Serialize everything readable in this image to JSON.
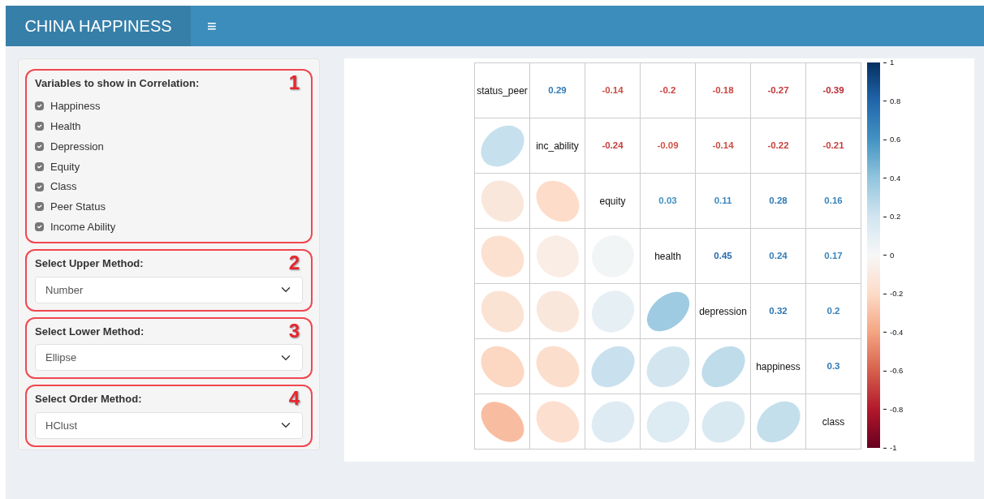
{
  "header": {
    "title": "CHINA HAPPINESS",
    "menu_glyph": "≡"
  },
  "sidebar": {
    "sections": [
      {
        "kind": "checkboxes",
        "marker": "1",
        "label": "Variables to show in Correlation:",
        "options": [
          {
            "label": "Happiness",
            "checked": true
          },
          {
            "label": "Health",
            "checked": true
          },
          {
            "label": "Depression",
            "checked": true
          },
          {
            "label": "Equity",
            "checked": true
          },
          {
            "label": "Class",
            "checked": true
          },
          {
            "label": "Peer Status",
            "checked": true
          },
          {
            "label": "Income Ability",
            "checked": true
          }
        ]
      },
      {
        "kind": "select",
        "marker": "2",
        "label": "Select Upper Method:",
        "value": "Number"
      },
      {
        "kind": "select",
        "marker": "3",
        "label": "Select Lower Method:",
        "value": "Ellipse"
      },
      {
        "kind": "select",
        "marker": "4",
        "label": "Select Order Method:",
        "value": "HClust"
      }
    ]
  },
  "correlation_plot": {
    "variables": [
      "status_peer",
      "inc_ability",
      "equity",
      "health",
      "depression",
      "happiness",
      "class"
    ],
    "upper_values": [
      [
        "0.29",
        "-0.14",
        "-0.2",
        "-0.18",
        "-0.27",
        "-0.39"
      ],
      [
        "-0.24",
        "-0.09",
        "-0.14",
        "-0.22",
        "-0.21"
      ],
      [
        "0.03",
        "0.11",
        "0.28",
        "0.16"
      ],
      [
        "0.45",
        "0.24",
        "0.17"
      ],
      [
        "0.32",
        "0.2"
      ],
      [
        "0.3"
      ]
    ],
    "colorbar": {
      "ticks": [
        "1",
        "0.8",
        "0.6",
        "0.4",
        "0.2",
        "0",
        "-0.2",
        "-0.4",
        "-0.6",
        "-0.8",
        "-1"
      ]
    }
  }
}
